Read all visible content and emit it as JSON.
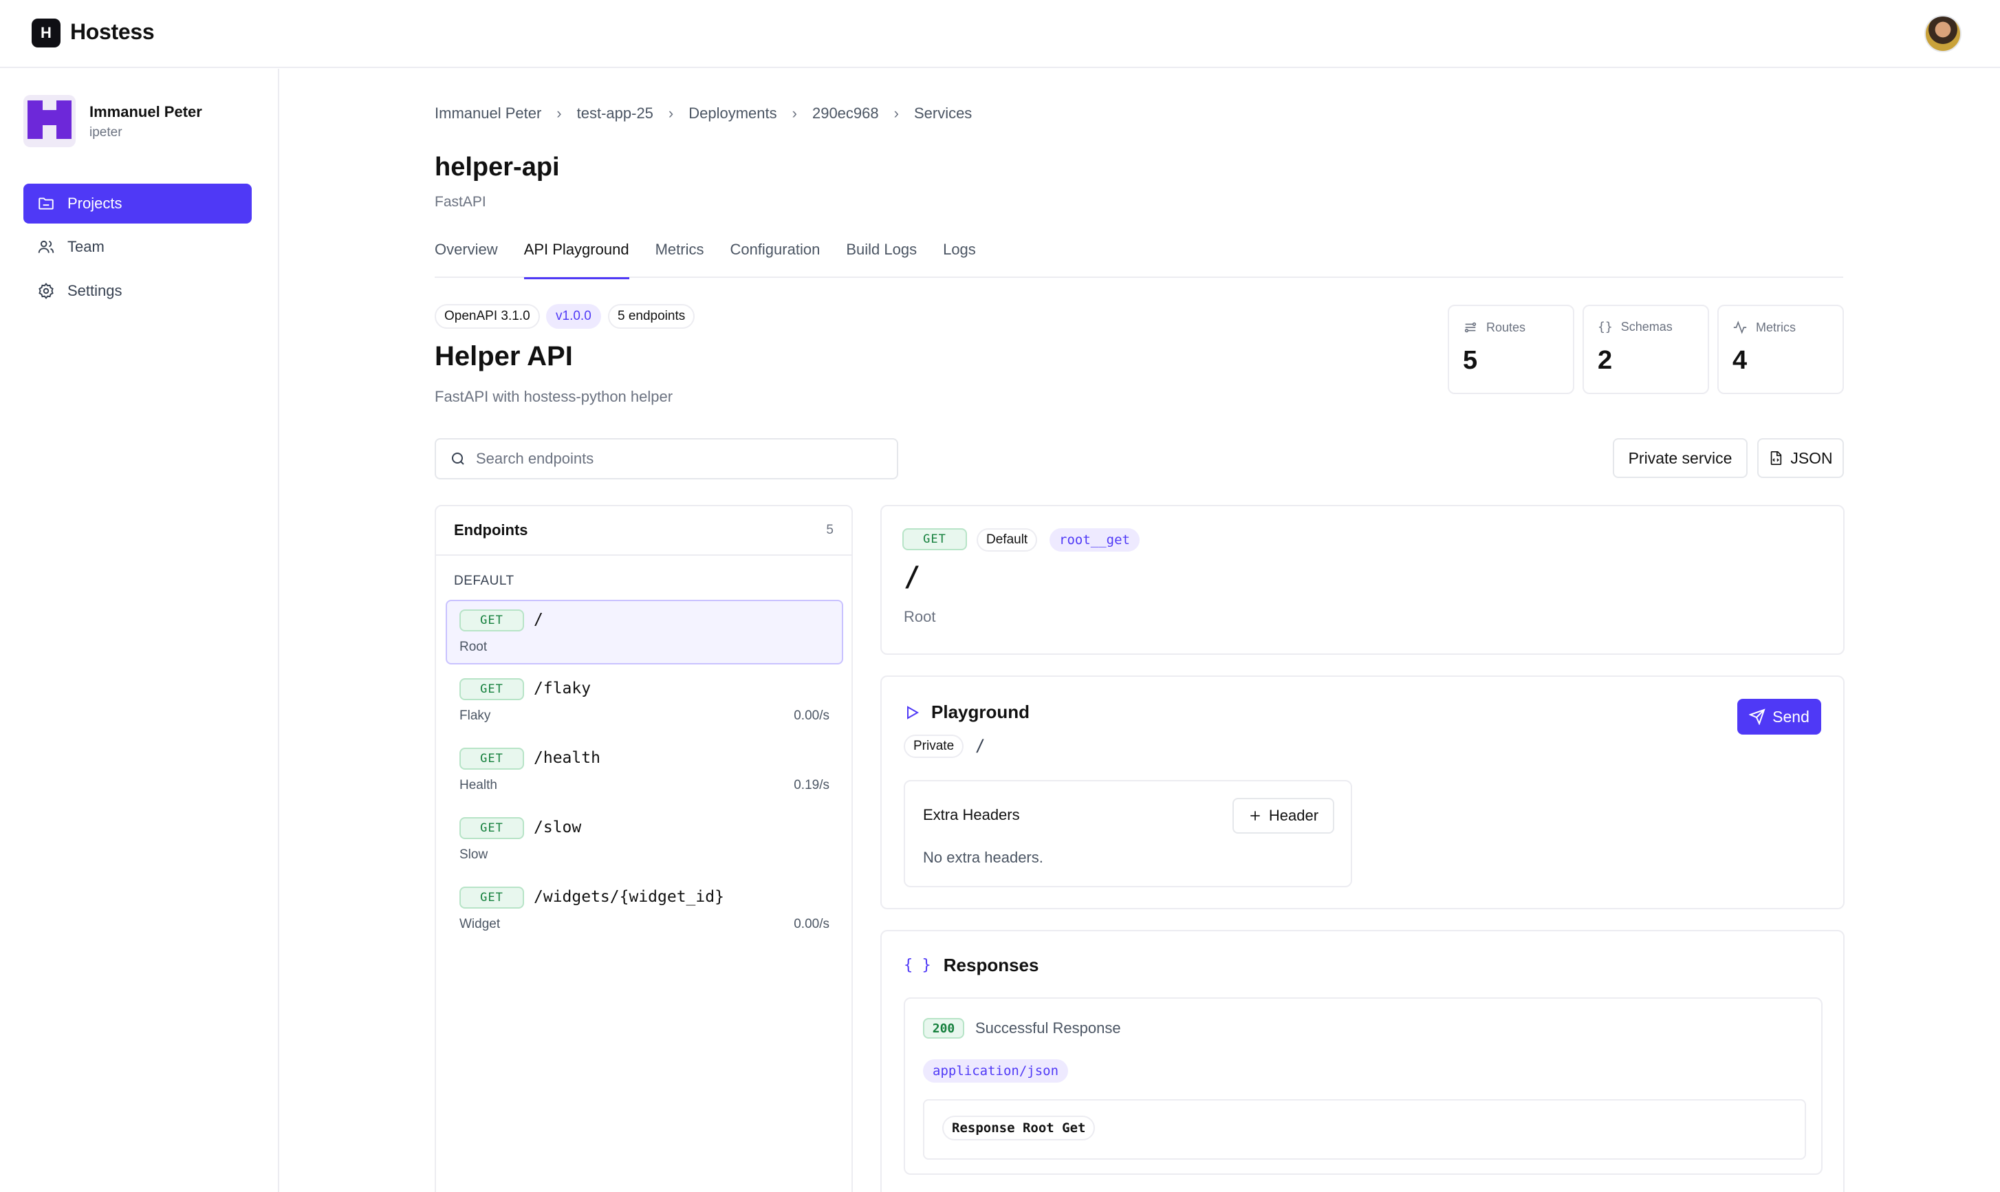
{
  "app": {
    "name": "Hostess",
    "logo_letter": "H"
  },
  "user": {
    "name": "Immanuel Peter",
    "handle": "ipeter"
  },
  "sidebar": {
    "items": [
      {
        "label": "Projects",
        "icon": "folder-icon",
        "active": true
      },
      {
        "label": "Team",
        "icon": "users-icon",
        "active": false
      },
      {
        "label": "Settings",
        "icon": "gear-icon",
        "active": false
      }
    ]
  },
  "breadcrumb": [
    "Immanuel Peter",
    "test-app-25",
    "Deployments",
    "290ec968",
    "Services"
  ],
  "page": {
    "title": "helper-api",
    "subtitle": "FastAPI"
  },
  "tabs": [
    "Overview",
    "API Playground",
    "Metrics",
    "Configuration",
    "Build Logs",
    "Logs"
  ],
  "active_tab": "API Playground",
  "api": {
    "chips": [
      "OpenAPI 3.1.0",
      "v1.0.0",
      "5 endpoints"
    ],
    "title": "Helper API",
    "description": "FastAPI with hostess-python helper"
  },
  "stats": [
    {
      "label": "Routes",
      "value": "5",
      "icon": "routes-icon"
    },
    {
      "label": "Schemas",
      "value": "2",
      "icon": "braces-icon"
    },
    {
      "label": "Metrics",
      "value": "4",
      "icon": "activity-icon"
    }
  ],
  "search": {
    "placeholder": "Search endpoints",
    "value": ""
  },
  "actions": {
    "private_service": "Private service",
    "json": "JSON"
  },
  "endpoints": {
    "title": "Endpoints",
    "count": "5",
    "group": "DEFAULT",
    "items": [
      {
        "method": "GET",
        "path": "/",
        "name": "Root",
        "rate": ""
      },
      {
        "method": "GET",
        "path": "/flaky",
        "name": "Flaky",
        "rate": "0.00/s"
      },
      {
        "method": "GET",
        "path": "/health",
        "name": "Health",
        "rate": "0.19/s"
      },
      {
        "method": "GET",
        "path": "/slow",
        "name": "Slow",
        "rate": ""
      },
      {
        "method": "GET",
        "path": "/widgets/{widget_id}",
        "name": "Widget",
        "rate": "0.00/s"
      }
    ]
  },
  "detail": {
    "method": "GET",
    "tag": "Default",
    "operation_id": "root__get",
    "path": "/",
    "summary": "Root"
  },
  "playground": {
    "title": "Playground",
    "send_label": "Send",
    "visibility": "Private",
    "path": "/",
    "headers_title": "Extra Headers",
    "add_header_label": "Header",
    "empty_headers": "No extra headers."
  },
  "responses": {
    "title": "Responses",
    "braces": "{ }",
    "code": "200",
    "description": "Successful Response",
    "mime": "application/json",
    "schema": "Response Root Get"
  },
  "colors": {
    "accent": "#4f39f6",
    "get_green": "#15803d",
    "border": "#ececf1"
  }
}
